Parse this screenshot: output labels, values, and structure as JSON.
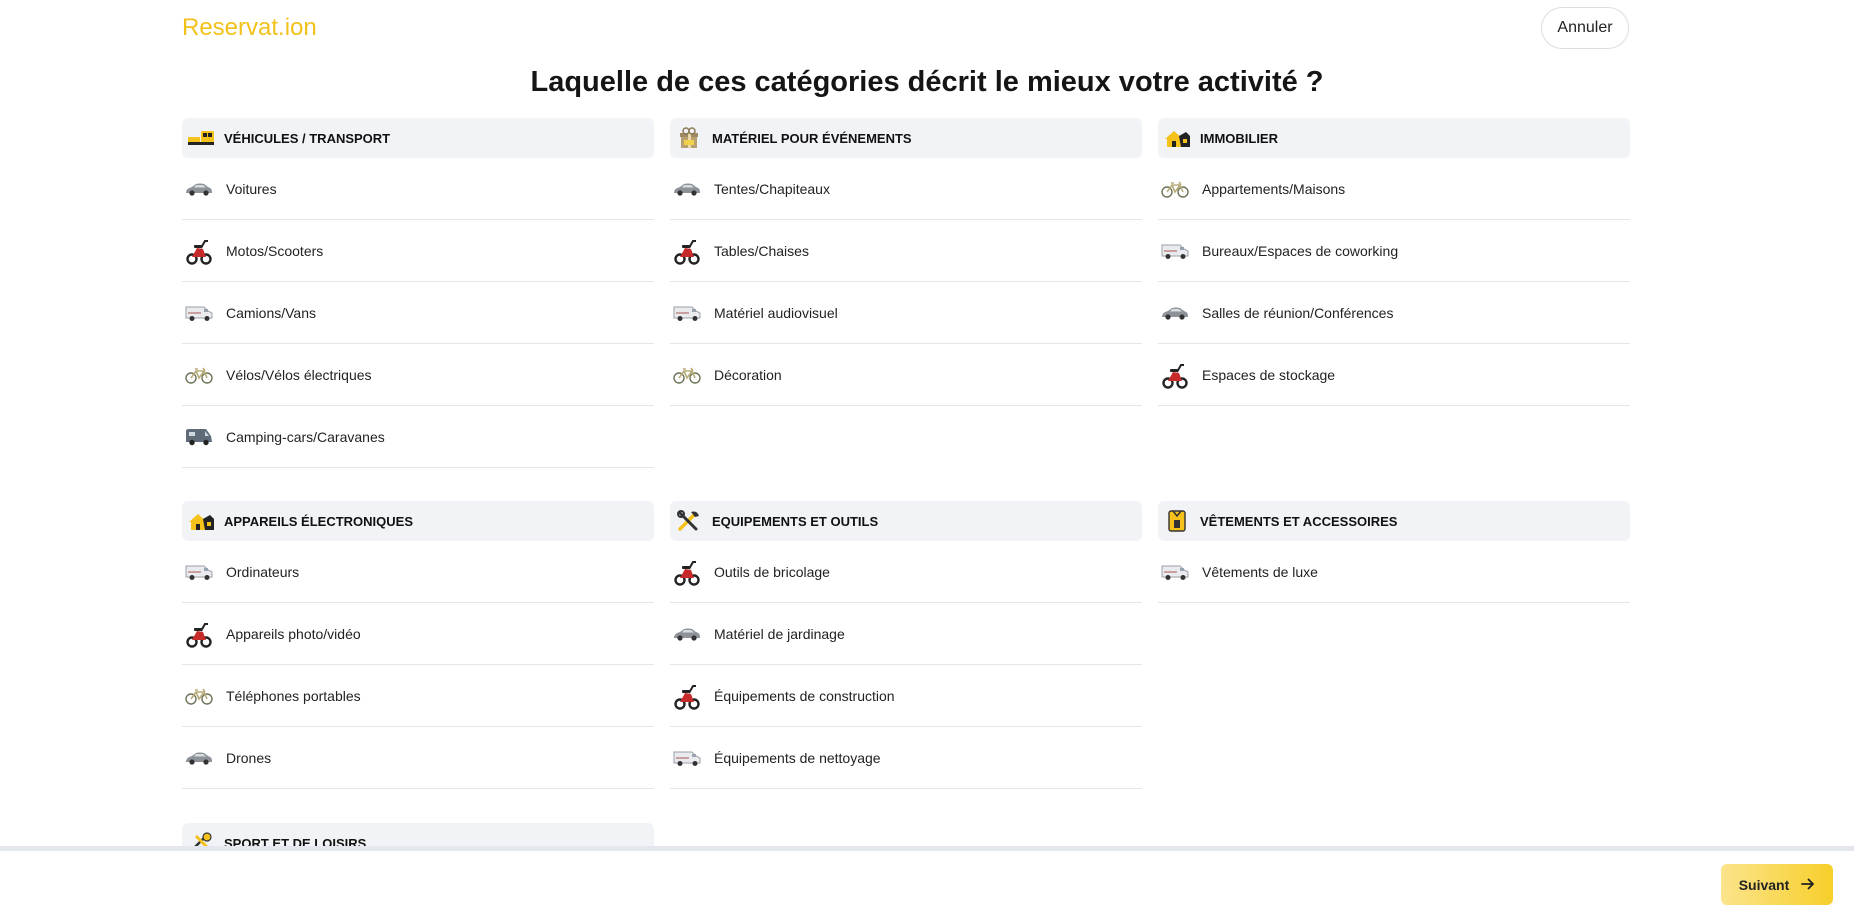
{
  "header": {
    "logo_text": "Reservat.ion",
    "cancel_label": "Annuler"
  },
  "page": {
    "title": "Laquelle de ces catégories décrit le mieux votre activité ?"
  },
  "categories": [
    {
      "label": "VÉHICULES / TRANSPORT",
      "icon": "vehicles-icon",
      "items": [
        {
          "label": "Voitures",
          "icon": "car-icon"
        },
        {
          "label": "Motos/Scooters",
          "icon": "scooter-icon"
        },
        {
          "label": "Camions/Vans",
          "icon": "van-icon"
        },
        {
          "label": "Vélos/Vélos électriques",
          "icon": "bicycle-icon"
        },
        {
          "label": "Camping-cars/Caravanes",
          "icon": "camper-icon"
        }
      ]
    },
    {
      "label": "MATÉRIEL POUR ÉVÉNEMENTS",
      "icon": "event-gift-icon",
      "items": [
        {
          "label": "Tentes/Chapiteaux",
          "icon": "car-icon"
        },
        {
          "label": "Tables/Chaises",
          "icon": "scooter-icon"
        },
        {
          "label": "Matériel audiovisuel",
          "icon": "van-icon"
        },
        {
          "label": "Décoration",
          "icon": "bicycle-icon"
        }
      ]
    },
    {
      "label": "IMMOBILIER",
      "icon": "house-icon",
      "items": [
        {
          "label": "Appartements/Maisons",
          "icon": "bicycle-icon"
        },
        {
          "label": "Bureaux/Espaces de coworking",
          "icon": "van-icon"
        },
        {
          "label": "Salles de réunion/Conférences",
          "icon": "car-icon"
        },
        {
          "label": "Espaces de stockage",
          "icon": "scooter-icon"
        }
      ]
    },
    {
      "label": "APPAREILS ÉLECTRONIQUES",
      "icon": "house-icon",
      "items": [
        {
          "label": "Ordinateurs",
          "icon": "van-icon"
        },
        {
          "label": "Appareils photo/vidéo",
          "icon": "scooter-icon"
        },
        {
          "label": "Téléphones portables",
          "icon": "bicycle-icon"
        },
        {
          "label": "Drones",
          "icon": "car-icon"
        }
      ]
    },
    {
      "label": "EQUIPEMENTS ET OUTILS",
      "icon": "tools-icon",
      "items": [
        {
          "label": "Outils de bricolage",
          "icon": "scooter-icon"
        },
        {
          "label": "Matériel de jardinage",
          "icon": "car-icon"
        },
        {
          "label": "Équipements de construction",
          "icon": "scooter-icon"
        },
        {
          "label": "Équipements de nettoyage",
          "icon": "van-icon"
        }
      ]
    },
    {
      "label": "VÊTEMENTS ET ACCESSOIRES",
      "icon": "clothing-icon",
      "items": [
        {
          "label": "Vêtements de luxe",
          "icon": "van-icon"
        }
      ]
    },
    {
      "label": "SPORT ET DE LOISIRS",
      "icon": "sport-icon",
      "items": []
    }
  ],
  "footer": {
    "next_label": "Suivant"
  },
  "colors": {
    "brand": "#f2c21b",
    "header_bg": "#f1f3f7",
    "next_button": "#f7cf2a"
  }
}
